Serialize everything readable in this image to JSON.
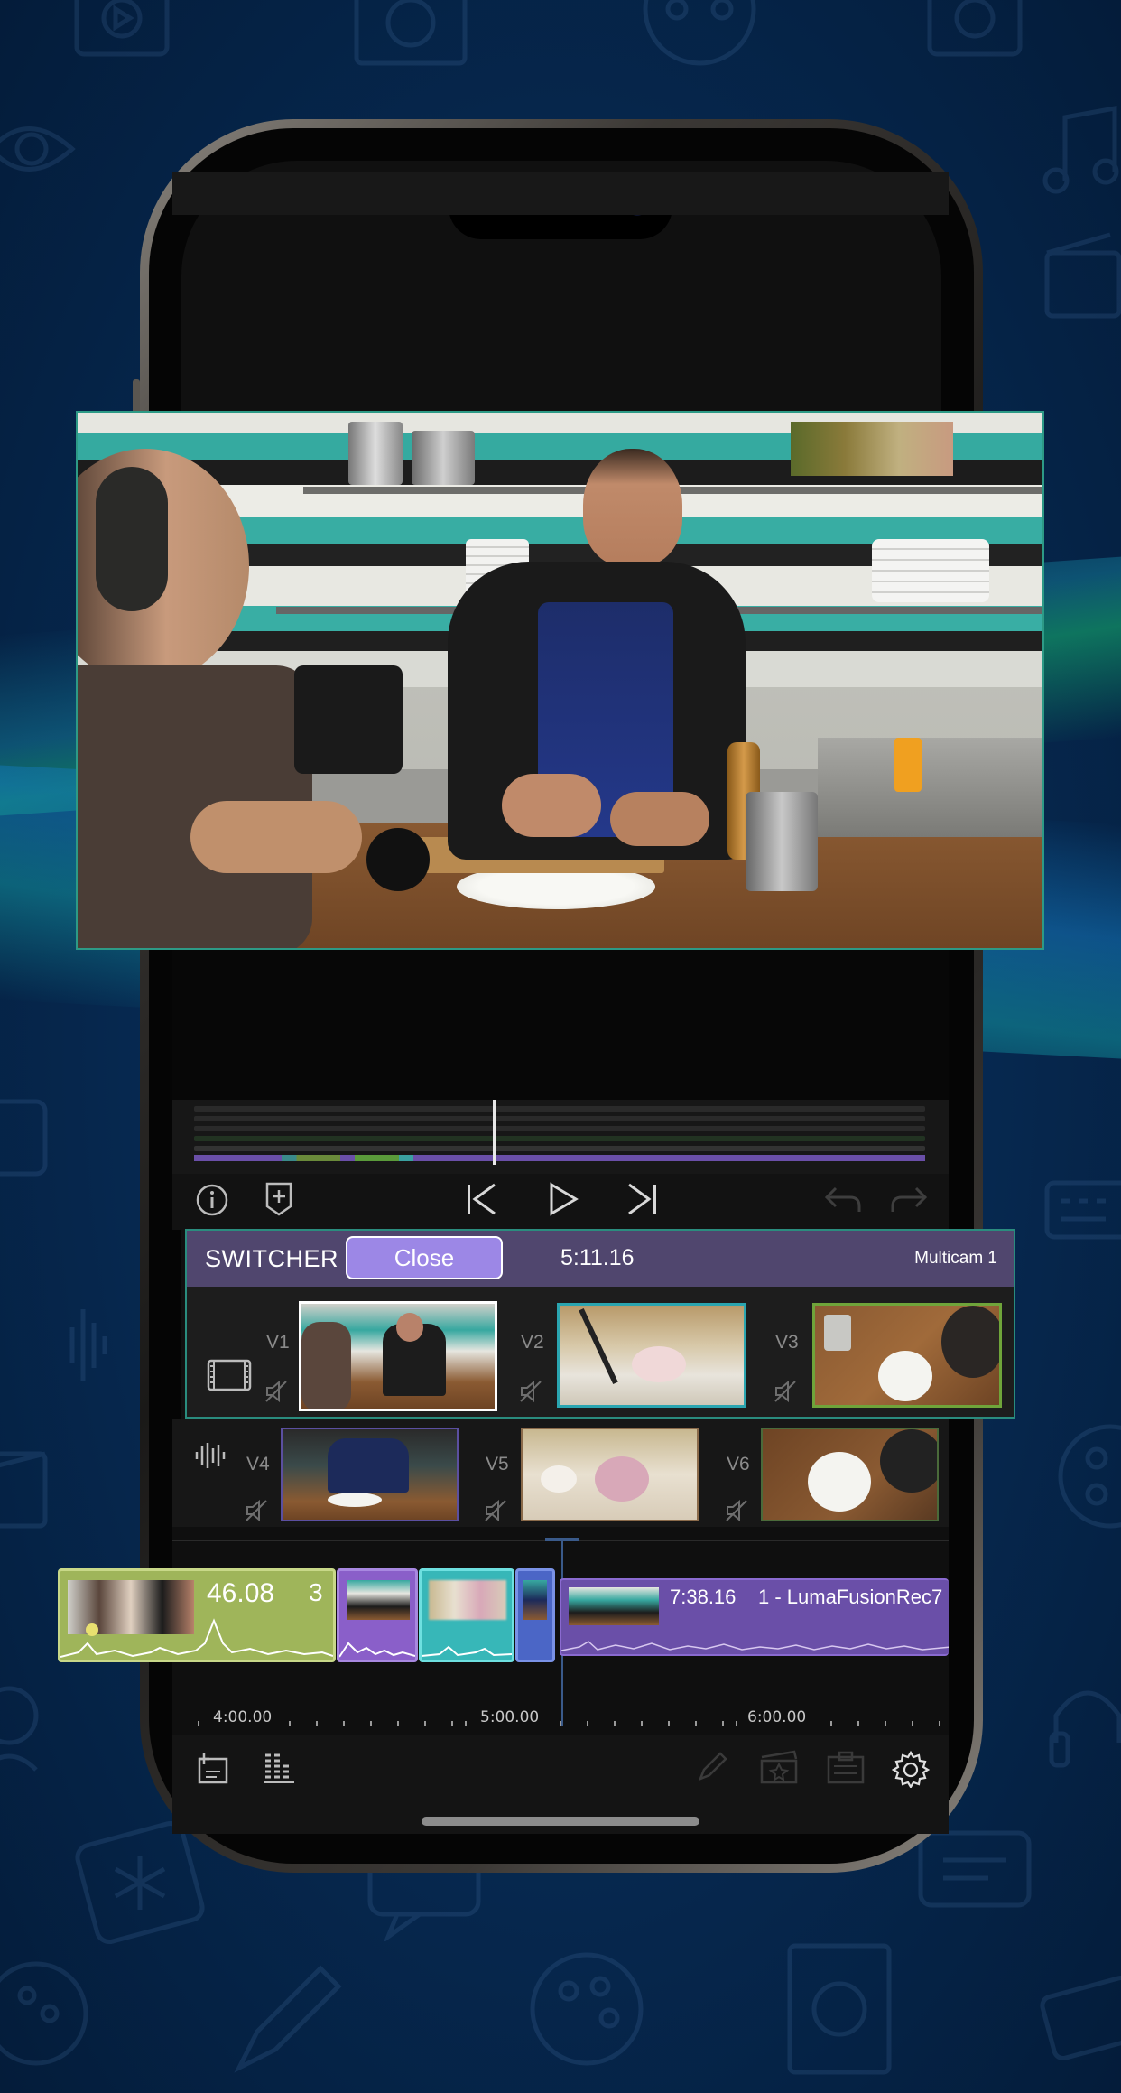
{
  "colors": {
    "background": "#06284f",
    "switcher_header": "#50466e",
    "close_button": "#9c87e6",
    "selected_angle_border": "#ffffff",
    "angle_border_teal": "#2aa5b0",
    "angle_border_green": "#6fa43a",
    "clip_green": "#9fb55a",
    "clip_purple": "#8a5fc9",
    "clip_teal": "#37b7b8",
    "clip_blue": "#4b66c6"
  },
  "transport": {
    "info_icon": "info-icon",
    "marker_icon": "add-marker-icon",
    "skip_back_icon": "skip-to-start-icon",
    "play_icon": "play-icon",
    "skip_forward_icon": "skip-to-end-icon",
    "undo_icon": "undo-icon",
    "redo_icon": "redo-icon"
  },
  "switcher": {
    "title": "SWITCHER",
    "close_label": "Close",
    "timecode": "5:11.16",
    "clip_name": "Multicam 1",
    "angles_top": [
      {
        "label": "V1",
        "selected": true
      },
      {
        "label": "V2",
        "selected": false
      },
      {
        "label": "V3",
        "selected": false
      }
    ],
    "angles_bottom": [
      {
        "label": "V4"
      },
      {
        "label": "V5"
      },
      {
        "label": "V6"
      }
    ]
  },
  "timeline": {
    "selected_clip_duration": "46.08",
    "selected_clip_badge": "3",
    "main_clip_duration": "7:38.16",
    "main_clip_name": "1 - LumaFusionRec7",
    "ruler": [
      "4:00.00",
      "5:00.00",
      "6:00.00"
    ]
  },
  "bottom_toolbar": {
    "add_title_icon": "add-title-icon",
    "audio_meter_icon": "audio-meter-icon",
    "edit_icon": "pencil-icon",
    "favorite_icon": "star-folder-icon",
    "clipboard_icon": "clipboard-icon",
    "settings_icon": "gear-icon"
  }
}
